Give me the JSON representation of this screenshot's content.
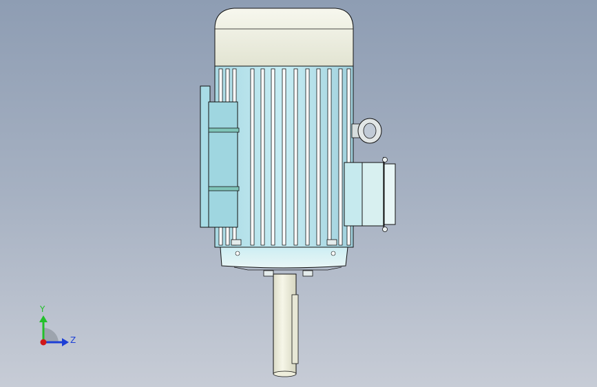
{
  "viewport": {
    "background_top": "#8e9db3",
    "background_bottom": "#c7ccd6"
  },
  "model": {
    "housing_color": "#bde6ef",
    "fan_cover_color": "#f4f4e6",
    "shaft_color": "#eeeedc",
    "edge_color": "#111111"
  },
  "triad": {
    "y_label": "Y",
    "z_label": "Z",
    "y_color": "#22c02a",
    "z_color": "#1d3fd6",
    "x_color": "#d01818"
  }
}
